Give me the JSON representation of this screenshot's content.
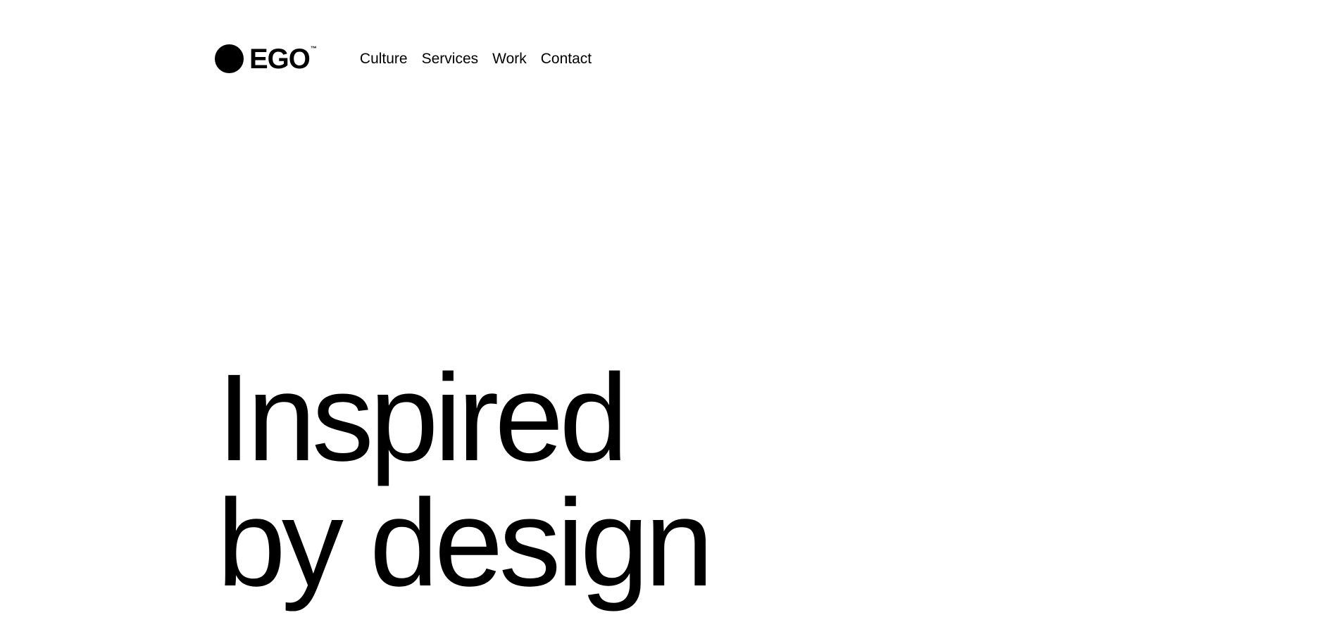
{
  "brand": {
    "name": "EGO",
    "trademark": "™"
  },
  "nav": {
    "items": [
      {
        "label": "Culture"
      },
      {
        "label": "Services"
      },
      {
        "label": "Work"
      },
      {
        "label": "Contact"
      }
    ]
  },
  "hero": {
    "line1": "Inspired",
    "line2": "by design"
  },
  "colors": {
    "background": "#ffffff",
    "text": "#000000"
  }
}
